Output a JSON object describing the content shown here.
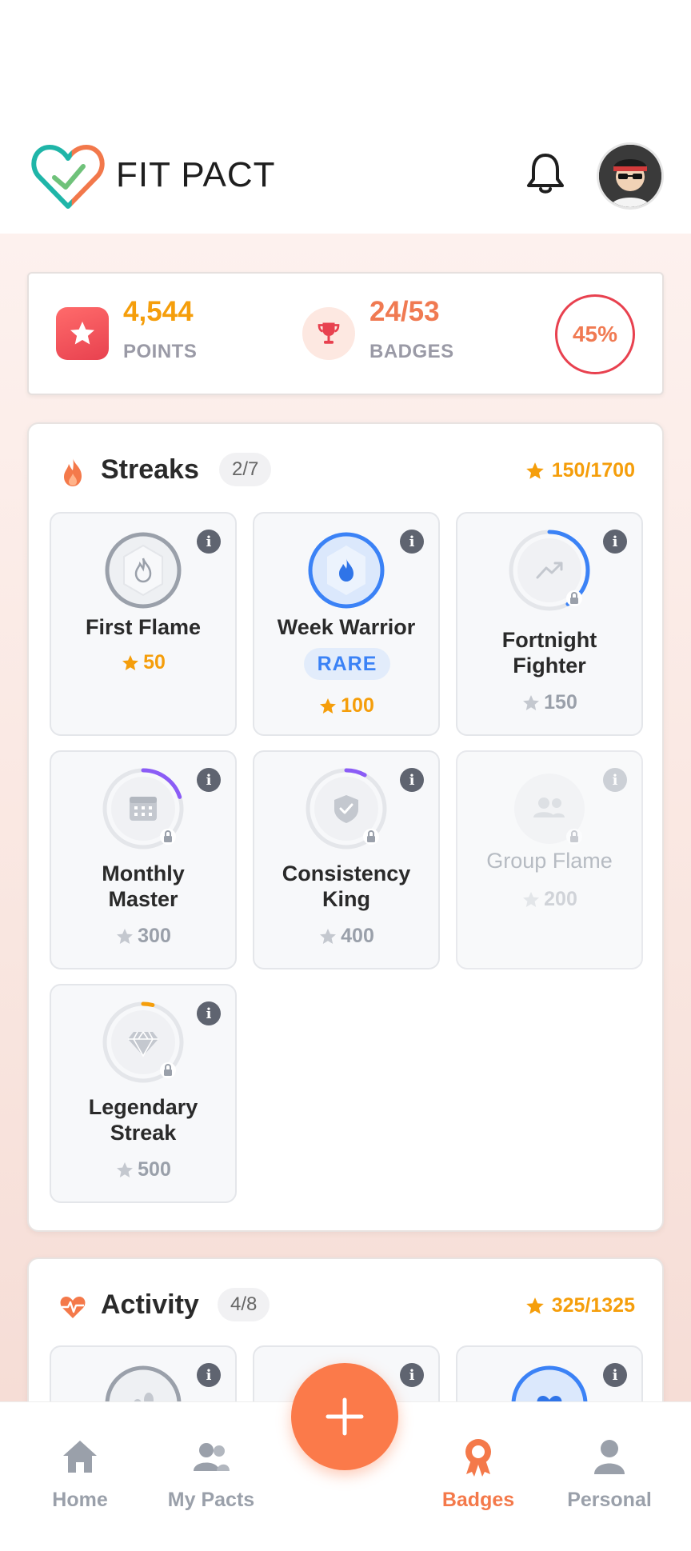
{
  "app": {
    "title": "FIT PACT"
  },
  "header": {
    "notification_icon": "bell-icon",
    "avatar_icon": "user-avatar"
  },
  "summary": {
    "points_value": "4,544",
    "points_label": "POINTS",
    "badges_value": "24/53",
    "badges_label": "BADGES",
    "progress_percent": "45%"
  },
  "streaks": {
    "title": "Streaks",
    "count": "2/7",
    "points": "150/1700",
    "badges": [
      {
        "name": "First Flame",
        "points": "50",
        "status": "earned",
        "icon": "flame-icon"
      },
      {
        "name": "Week Warrior",
        "points": "100",
        "status": "earned",
        "rarity": "RARE",
        "icon": "flame-icon"
      },
      {
        "name_line1": "Fortnight",
        "name_line2": "Fighter",
        "points": "150",
        "status": "locked",
        "progress": 0.42,
        "icon": "trending-up-icon"
      },
      {
        "name_line1": "Monthly",
        "name_line2": "Master",
        "points": "300",
        "status": "locked",
        "progress": 0.2,
        "icon": "calendar-icon"
      },
      {
        "name_line1": "Consistency",
        "name_line2": "King",
        "points": "400",
        "status": "locked",
        "progress": 0.08,
        "icon": "shield-check-icon"
      },
      {
        "name": "Group Flame",
        "points": "200",
        "status": "locked-faded",
        "icon": "group-icon"
      },
      {
        "name_line1": "Legendary",
        "name_line2": "Streak",
        "points": "500",
        "status": "locked",
        "progress": 0.04,
        "icon": "diamond-icon"
      }
    ]
  },
  "activity": {
    "title": "Activity",
    "count": "4/8",
    "points": "325/1325"
  },
  "nav": {
    "items": [
      {
        "label": "Home",
        "icon": "home-icon"
      },
      {
        "label": "My Pacts",
        "icon": "people-icon"
      },
      {
        "label": "Badges",
        "icon": "badge-icon",
        "active": true
      },
      {
        "label": "Personal",
        "icon": "person-icon"
      }
    ],
    "fab_icon": "plus-icon"
  },
  "colors": {
    "accent": "#fb7a4a",
    "gold": "#f59e0b",
    "blue": "#3b82f6",
    "purple": "#8b5cf6",
    "red": "#e8414f"
  }
}
